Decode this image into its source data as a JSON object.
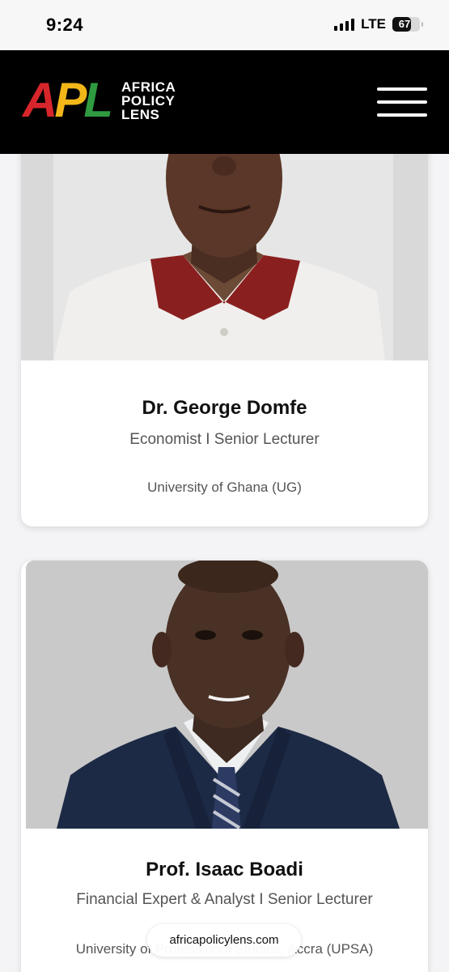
{
  "status_bar": {
    "time": "9:24",
    "network": "LTE",
    "battery": "67",
    "battery_level": 0.67
  },
  "header": {
    "logo": {
      "letters": [
        "A",
        "P",
        "L"
      ],
      "words": [
        "AFRICA",
        "POLICY",
        "LENS"
      ]
    },
    "menu_icon": "hamburger-icon"
  },
  "profiles": [
    {
      "name": "Dr. George Domfe",
      "role": "Economist I Senior Lecturer",
      "organization": "University of Ghana (UG)"
    },
    {
      "name": "Prof. Isaac Boadi",
      "role": "Financial Expert & Analyst I Senior Lecturer",
      "organization": "University of Professional Studies, Accra (UPSA)"
    }
  ],
  "url_bar": {
    "domain": "africapolicylens.com"
  },
  "colors": {
    "logo_red": "#d7262b",
    "logo_yellow": "#f2b619",
    "logo_green": "#2f9a3f",
    "header_bg": "#000000"
  }
}
